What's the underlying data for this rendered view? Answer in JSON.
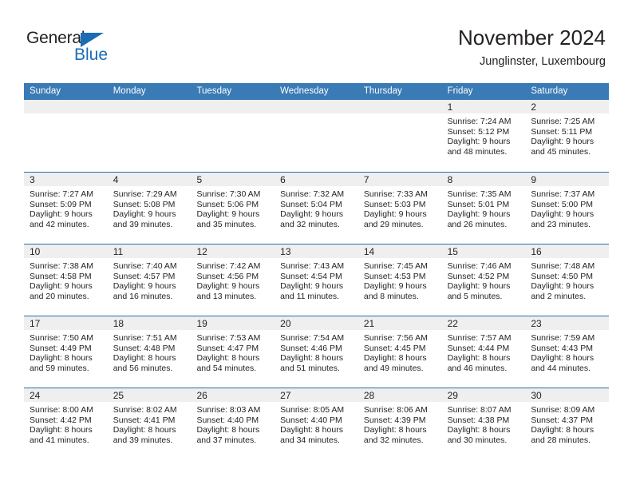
{
  "brand": {
    "name_part1": "General",
    "name_part2": "Blue",
    "triangle_color": "#1b6cb5"
  },
  "header": {
    "title": "November 2024",
    "subtitle": "Junglinster, Luxembourg"
  },
  "calendar": {
    "header_color": "#3a7ab5",
    "daynum_strip_color": "#efefef",
    "weekday_headers": [
      "Sunday",
      "Monday",
      "Tuesday",
      "Wednesday",
      "Thursday",
      "Friday",
      "Saturday"
    ],
    "weeks": [
      [
        {
          "day": "",
          "sunrise": "",
          "sunset": "",
          "daylight1": "",
          "daylight2": ""
        },
        {
          "day": "",
          "sunrise": "",
          "sunset": "",
          "daylight1": "",
          "daylight2": ""
        },
        {
          "day": "",
          "sunrise": "",
          "sunset": "",
          "daylight1": "",
          "daylight2": ""
        },
        {
          "day": "",
          "sunrise": "",
          "sunset": "",
          "daylight1": "",
          "daylight2": ""
        },
        {
          "day": "",
          "sunrise": "",
          "sunset": "",
          "daylight1": "",
          "daylight2": ""
        },
        {
          "day": "1",
          "sunrise": "Sunrise: 7:24 AM",
          "sunset": "Sunset: 5:12 PM",
          "daylight1": "Daylight: 9 hours",
          "daylight2": "and 48 minutes."
        },
        {
          "day": "2",
          "sunrise": "Sunrise: 7:25 AM",
          "sunset": "Sunset: 5:11 PM",
          "daylight1": "Daylight: 9 hours",
          "daylight2": "and 45 minutes."
        }
      ],
      [
        {
          "day": "3",
          "sunrise": "Sunrise: 7:27 AM",
          "sunset": "Sunset: 5:09 PM",
          "daylight1": "Daylight: 9 hours",
          "daylight2": "and 42 minutes."
        },
        {
          "day": "4",
          "sunrise": "Sunrise: 7:29 AM",
          "sunset": "Sunset: 5:08 PM",
          "daylight1": "Daylight: 9 hours",
          "daylight2": "and 39 minutes."
        },
        {
          "day": "5",
          "sunrise": "Sunrise: 7:30 AM",
          "sunset": "Sunset: 5:06 PM",
          "daylight1": "Daylight: 9 hours",
          "daylight2": "and 35 minutes."
        },
        {
          "day": "6",
          "sunrise": "Sunrise: 7:32 AM",
          "sunset": "Sunset: 5:04 PM",
          "daylight1": "Daylight: 9 hours",
          "daylight2": "and 32 minutes."
        },
        {
          "day": "7",
          "sunrise": "Sunrise: 7:33 AM",
          "sunset": "Sunset: 5:03 PM",
          "daylight1": "Daylight: 9 hours",
          "daylight2": "and 29 minutes."
        },
        {
          "day": "8",
          "sunrise": "Sunrise: 7:35 AM",
          "sunset": "Sunset: 5:01 PM",
          "daylight1": "Daylight: 9 hours",
          "daylight2": "and 26 minutes."
        },
        {
          "day": "9",
          "sunrise": "Sunrise: 7:37 AM",
          "sunset": "Sunset: 5:00 PM",
          "daylight1": "Daylight: 9 hours",
          "daylight2": "and 23 minutes."
        }
      ],
      [
        {
          "day": "10",
          "sunrise": "Sunrise: 7:38 AM",
          "sunset": "Sunset: 4:58 PM",
          "daylight1": "Daylight: 9 hours",
          "daylight2": "and 20 minutes."
        },
        {
          "day": "11",
          "sunrise": "Sunrise: 7:40 AM",
          "sunset": "Sunset: 4:57 PM",
          "daylight1": "Daylight: 9 hours",
          "daylight2": "and 16 minutes."
        },
        {
          "day": "12",
          "sunrise": "Sunrise: 7:42 AM",
          "sunset": "Sunset: 4:56 PM",
          "daylight1": "Daylight: 9 hours",
          "daylight2": "and 13 minutes."
        },
        {
          "day": "13",
          "sunrise": "Sunrise: 7:43 AM",
          "sunset": "Sunset: 4:54 PM",
          "daylight1": "Daylight: 9 hours",
          "daylight2": "and 11 minutes."
        },
        {
          "day": "14",
          "sunrise": "Sunrise: 7:45 AM",
          "sunset": "Sunset: 4:53 PM",
          "daylight1": "Daylight: 9 hours",
          "daylight2": "and 8 minutes."
        },
        {
          "day": "15",
          "sunrise": "Sunrise: 7:46 AM",
          "sunset": "Sunset: 4:52 PM",
          "daylight1": "Daylight: 9 hours",
          "daylight2": "and 5 minutes."
        },
        {
          "day": "16",
          "sunrise": "Sunrise: 7:48 AM",
          "sunset": "Sunset: 4:50 PM",
          "daylight1": "Daylight: 9 hours",
          "daylight2": "and 2 minutes."
        }
      ],
      [
        {
          "day": "17",
          "sunrise": "Sunrise: 7:50 AM",
          "sunset": "Sunset: 4:49 PM",
          "daylight1": "Daylight: 8 hours",
          "daylight2": "and 59 minutes."
        },
        {
          "day": "18",
          "sunrise": "Sunrise: 7:51 AM",
          "sunset": "Sunset: 4:48 PM",
          "daylight1": "Daylight: 8 hours",
          "daylight2": "and 56 minutes."
        },
        {
          "day": "19",
          "sunrise": "Sunrise: 7:53 AM",
          "sunset": "Sunset: 4:47 PM",
          "daylight1": "Daylight: 8 hours",
          "daylight2": "and 54 minutes."
        },
        {
          "day": "20",
          "sunrise": "Sunrise: 7:54 AM",
          "sunset": "Sunset: 4:46 PM",
          "daylight1": "Daylight: 8 hours",
          "daylight2": "and 51 minutes."
        },
        {
          "day": "21",
          "sunrise": "Sunrise: 7:56 AM",
          "sunset": "Sunset: 4:45 PM",
          "daylight1": "Daylight: 8 hours",
          "daylight2": "and 49 minutes."
        },
        {
          "day": "22",
          "sunrise": "Sunrise: 7:57 AM",
          "sunset": "Sunset: 4:44 PM",
          "daylight1": "Daylight: 8 hours",
          "daylight2": "and 46 minutes."
        },
        {
          "day": "23",
          "sunrise": "Sunrise: 7:59 AM",
          "sunset": "Sunset: 4:43 PM",
          "daylight1": "Daylight: 8 hours",
          "daylight2": "and 44 minutes."
        }
      ],
      [
        {
          "day": "24",
          "sunrise": "Sunrise: 8:00 AM",
          "sunset": "Sunset: 4:42 PM",
          "daylight1": "Daylight: 8 hours",
          "daylight2": "and 41 minutes."
        },
        {
          "day": "25",
          "sunrise": "Sunrise: 8:02 AM",
          "sunset": "Sunset: 4:41 PM",
          "daylight1": "Daylight: 8 hours",
          "daylight2": "and 39 minutes."
        },
        {
          "day": "26",
          "sunrise": "Sunrise: 8:03 AM",
          "sunset": "Sunset: 4:40 PM",
          "daylight1": "Daylight: 8 hours",
          "daylight2": "and 37 minutes."
        },
        {
          "day": "27",
          "sunrise": "Sunrise: 8:05 AM",
          "sunset": "Sunset: 4:40 PM",
          "daylight1": "Daylight: 8 hours",
          "daylight2": "and 34 minutes."
        },
        {
          "day": "28",
          "sunrise": "Sunrise: 8:06 AM",
          "sunset": "Sunset: 4:39 PM",
          "daylight1": "Daylight: 8 hours",
          "daylight2": "and 32 minutes."
        },
        {
          "day": "29",
          "sunrise": "Sunrise: 8:07 AM",
          "sunset": "Sunset: 4:38 PM",
          "daylight1": "Daylight: 8 hours",
          "daylight2": "and 30 minutes."
        },
        {
          "day": "30",
          "sunrise": "Sunrise: 8:09 AM",
          "sunset": "Sunset: 4:37 PM",
          "daylight1": "Daylight: 8 hours",
          "daylight2": "and 28 minutes."
        }
      ]
    ]
  }
}
